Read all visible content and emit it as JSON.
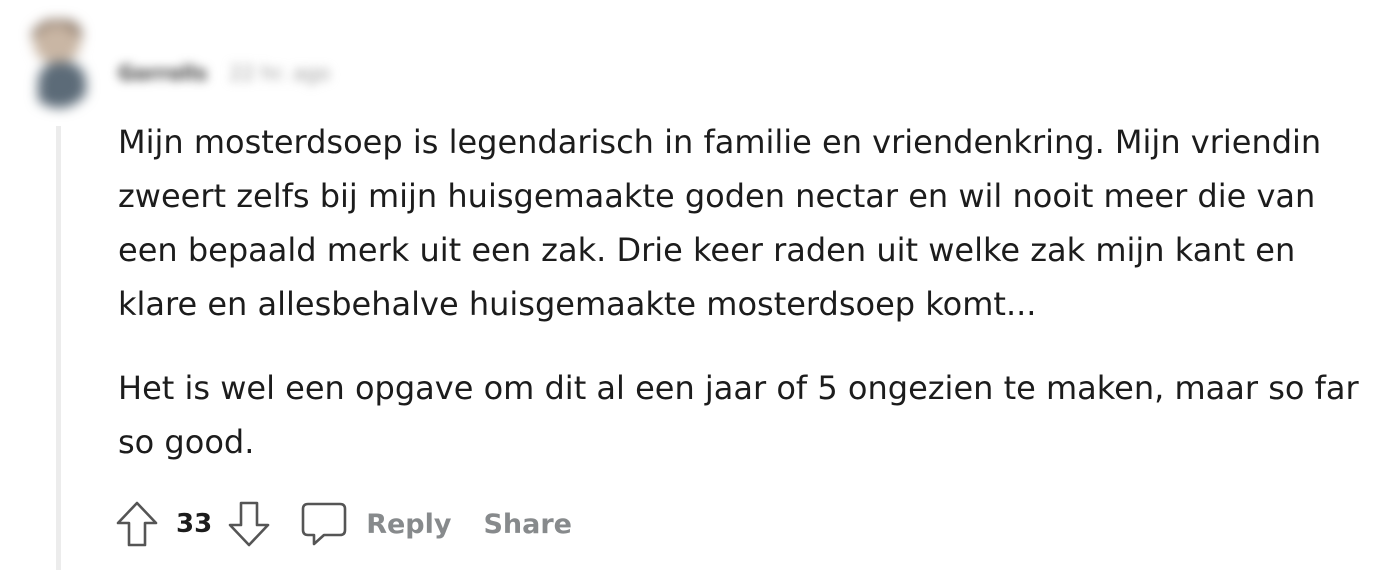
{
  "comment": {
    "author": "Gorrolls",
    "time": "22 hr. ago",
    "paragraphs": [
      "Mijn mosterdsoep is legendarisch in familie en vriendenkring. Mijn vriendin zweert zelfs bij mijn huisgemaakte goden nectar en wil nooit meer die van een bepaald merk uit een zak. Drie keer raden uit welke zak mijn kant en klare en allesbehalve huisgemaakte mosterdsoep komt...",
      "Het is wel een opgave om dit al een jaar of 5 ongezien te maken, maar so far so good."
    ]
  },
  "actions": {
    "score": "33",
    "reply_label": "Reply",
    "share_label": "Share",
    "icons": {
      "upvote": "arrow-up-outline-icon",
      "downvote": "arrow-down-outline-icon",
      "reply": "speech-bubble-icon"
    }
  },
  "colors": {
    "text": "#1c1c1c",
    "muted": "#878a8c",
    "thread_line": "#ececec"
  }
}
